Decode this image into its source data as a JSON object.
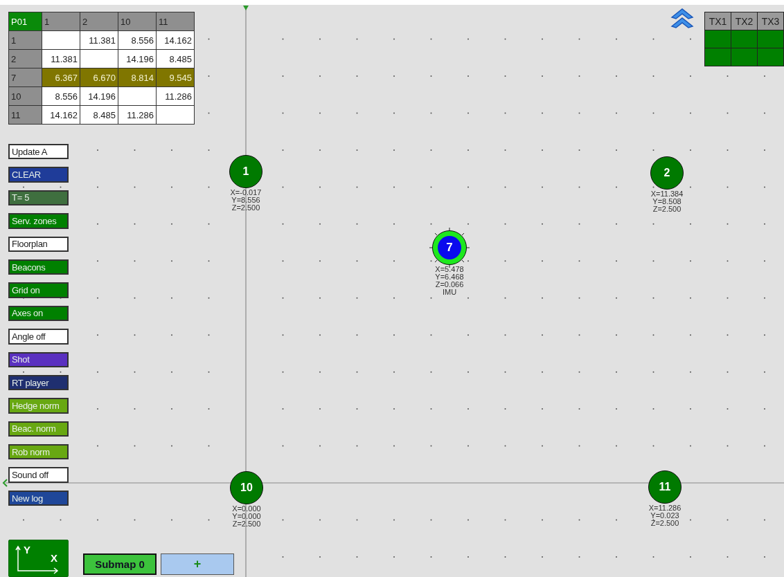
{
  "distance_table": {
    "corner": "P01",
    "columns": [
      "1",
      "2",
      "10",
      "11"
    ],
    "rows": [
      {
        "label": "1",
        "selected": false,
        "cells": [
          null,
          "11.381",
          "8.556",
          "14.162"
        ]
      },
      {
        "label": "2",
        "selected": false,
        "cells": [
          "11.381",
          null,
          "14.196",
          "8.485"
        ]
      },
      {
        "label": "7",
        "selected": true,
        "cells": [
          "6.367",
          "6.670",
          "8.814",
          "9.545"
        ]
      },
      {
        "label": "10",
        "selected": false,
        "cells": [
          "8.556",
          "14.196",
          null,
          "11.286"
        ]
      },
      {
        "label": "11",
        "selected": false,
        "cells": [
          "14.162",
          "8.485",
          "11.286",
          null
        ]
      }
    ]
  },
  "buttons": [
    {
      "label": "Update A",
      "color": "#ffffff"
    },
    {
      "label": "CLEAR",
      "color": "#1f3c99"
    },
    {
      "label": "T= 5",
      "color": "#3f6f3f"
    },
    {
      "label": "Serv. zones",
      "color": "#008000"
    },
    {
      "label": "Floorplan",
      "color": "#ffffff"
    },
    {
      "label": "Beacons",
      "color": "#008000"
    },
    {
      "label": "Grid on",
      "color": "#008000"
    },
    {
      "label": "Axes on",
      "color": "#008000"
    },
    {
      "label": "Angle off",
      "color": "#ffffff"
    },
    {
      "label": "Shot",
      "color": "#5a30c0"
    },
    {
      "label": "RT player",
      "color": "#1f2f70"
    },
    {
      "label": "Hedge norm",
      "color": "#68a812"
    },
    {
      "label": "Beac. norm",
      "color": "#68a812"
    },
    {
      "label": "Rob norm",
      "color": "#68a812"
    },
    {
      "label": "Sound off",
      "color": "#ffffff"
    },
    {
      "label": "New log",
      "color": "#1f4799"
    }
  ],
  "tx_table": {
    "columns": [
      "TX1",
      "TX2",
      "TX3"
    ],
    "rows": [
      {
        "cells": [
          {
            "on": true
          },
          {
            "on": true
          },
          {
            "on": true
          }
        ]
      },
      {
        "cells": [
          {
            "on": true
          },
          {
            "on": true
          },
          {
            "on": true
          }
        ]
      }
    ]
  },
  "nodes": [
    {
      "id": "1",
      "kind": "beacon",
      "lines": [
        "X=-0.017",
        "Y=8.556",
        "Z=2.500"
      ]
    },
    {
      "id": "2",
      "kind": "beacon",
      "lines": [
        "X=11.384",
        "Y=8.508",
        "Z=2.500"
      ]
    },
    {
      "id": "7",
      "kind": "robot",
      "lines": [
        "X=5.478",
        "Y=6.468",
        "Z=0.066",
        "IMU"
      ]
    },
    {
      "id": "10",
      "kind": "beacon",
      "lines": [
        "X=0.000",
        "Y=0.000",
        "Z=2.500"
      ]
    },
    {
      "id": "11",
      "kind": "beacon",
      "lines": [
        "X=11.286",
        "Y=0.023",
        "Z=2.500"
      ]
    }
  ],
  "axes_button": {
    "y_label": "Y",
    "x_label": "X"
  },
  "submap_button": {
    "label": "Submap 0"
  },
  "add_button": {
    "label": "+"
  }
}
